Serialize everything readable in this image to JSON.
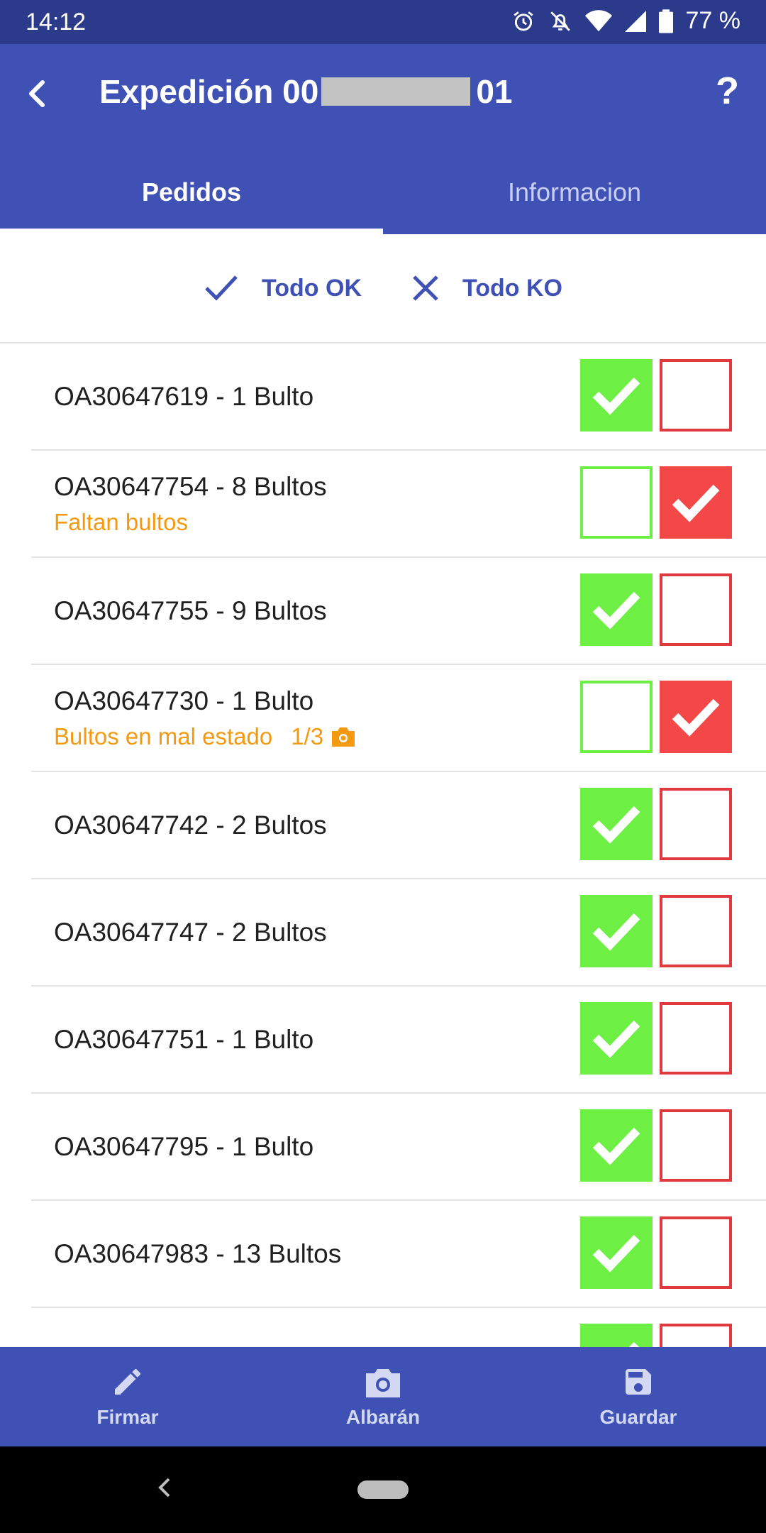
{
  "status_bar": {
    "time": "14:12",
    "battery": "77 %",
    "icons": [
      "alarm-icon",
      "do-not-disturb-icon",
      "wifi-icon",
      "signal-icon",
      "battery-icon"
    ]
  },
  "app_bar": {
    "title_prefix": "Expedición 00",
    "title_suffix": "01",
    "help_label": "?"
  },
  "tabs": [
    {
      "label": "Pedidos",
      "active": true
    },
    {
      "label": "Informacion",
      "active": false
    }
  ],
  "actions": {
    "all_ok": "Todo OK",
    "all_ko": "Todo KO"
  },
  "orders": [
    {
      "label": "OA30647619 - 1 Bulto",
      "note": "",
      "count": "",
      "status": "ok"
    },
    {
      "label": "OA30647754 - 8 Bultos",
      "note": "Faltan bultos",
      "count": "",
      "status": "ko"
    },
    {
      "label": "OA30647755 - 9 Bultos",
      "note": "",
      "count": "",
      "status": "ok"
    },
    {
      "label": "OA30647730 - 1 Bulto",
      "note": "Bultos en mal estado",
      "count": "1/3",
      "status": "ko"
    },
    {
      "label": "OA30647742 - 2 Bultos",
      "note": "",
      "count": "",
      "status": "ok"
    },
    {
      "label": "OA30647747 - 2 Bultos",
      "note": "",
      "count": "",
      "status": "ok"
    },
    {
      "label": "OA30647751 - 1 Bulto",
      "note": "",
      "count": "",
      "status": "ok"
    },
    {
      "label": "OA30647795 - 1 Bulto",
      "note": "",
      "count": "",
      "status": "ok"
    },
    {
      "label": "OA30647983 - 13 Bultos",
      "note": "",
      "count": "",
      "status": "ok"
    },
    {
      "label": "",
      "note": "",
      "count": "",
      "status": "ok"
    }
  ],
  "bottom_nav": {
    "sign": "Firmar",
    "delivery_note": "Albarán",
    "save": "Guardar"
  },
  "colors": {
    "primary": "#3f51b5",
    "status_bar": "#2c3a8c",
    "ok_green": "#6df043",
    "ko_red": "#f44848",
    "warning_orange": "#f59a10"
  }
}
